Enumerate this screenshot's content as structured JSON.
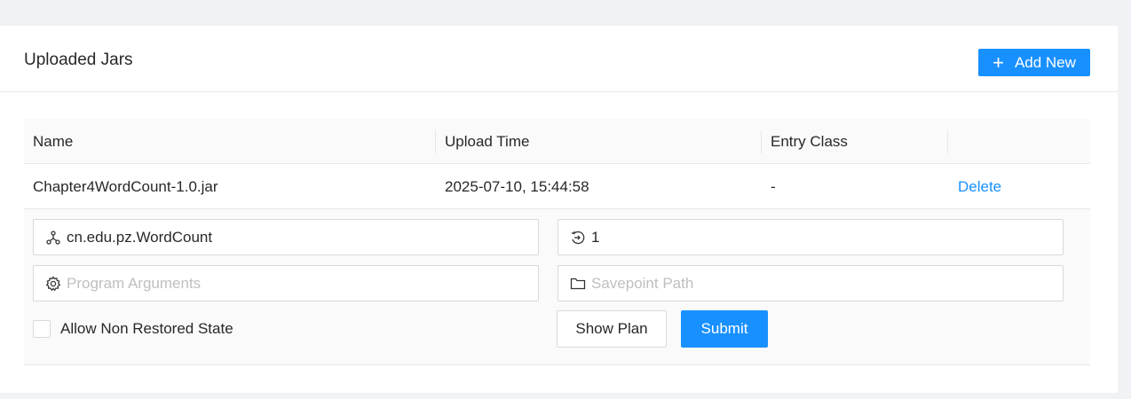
{
  "card": {
    "title": "Uploaded Jars",
    "add_button_label": "Add New"
  },
  "table": {
    "headers": [
      "Name",
      "Upload Time",
      "Entry Class",
      ""
    ],
    "rows": [
      {
        "name": "Chapter4WordCount-1.0.jar",
        "upload_time": "2025-07-10, 15:44:58",
        "entry_class": "-",
        "action": "Delete"
      }
    ]
  },
  "submit_form": {
    "entry_class_value": "cn.edu.pz.WordCount",
    "parallelism_value": "1",
    "program_args_placeholder": "Program Arguments",
    "savepoint_placeholder": "Savepoint Path",
    "allow_non_restored_label": "Allow Non Restored State",
    "allow_non_restored_checked": false,
    "show_plan_label": "Show Plan",
    "submit_label": "Submit"
  },
  "icons": {
    "entry_class": "cluster-icon",
    "parallelism": "parallelism-icon",
    "program_args": "gear-icon",
    "savepoint": "folder-icon",
    "add": "plus-icon"
  },
  "colors": {
    "primary": "#1890ff",
    "page_bg": "#f0f2f5"
  }
}
